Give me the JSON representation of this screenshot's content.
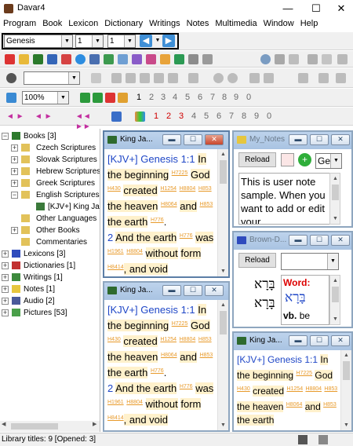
{
  "window": {
    "title": "Davar4",
    "minimize": "—",
    "maximize": "☐",
    "close": "✕"
  },
  "menu": [
    "Program",
    "Book",
    "Lexicon",
    "Dictionary",
    "Writings",
    "Notes",
    "Multimedia",
    "Window",
    "Help"
  ],
  "nav": {
    "book": "Genesis",
    "chapter": "1",
    "verse": "1"
  },
  "toolbar3": {
    "zoom": "100%"
  },
  "numbers_gray": [
    "1",
    "2",
    "3",
    "4",
    "5",
    "6",
    "7",
    "8",
    "9",
    "0"
  ],
  "numbers_red": [
    "1",
    "2",
    "3"
  ],
  "numbers_red_rest": [
    "4",
    "5",
    "6",
    "7",
    "8",
    "9",
    "0"
  ],
  "tree": {
    "books": "Books [3]",
    "czech": "Czech Scriptures",
    "slovak": "Slovak Scriptures",
    "hebrew": "Hebrew Scriptures",
    "greek": "Greek Scriptures",
    "english": "English Scriptures",
    "kjv": "[KJV+] King Ja",
    "other_lang": "Other Languages",
    "other_books": "Other Books",
    "commentaries": "Commentaries",
    "lexicons": "Lexicons [3]",
    "dictionaries": "Dictionaries [1]",
    "writings": "Writings [1]",
    "notes": "Notes [1]",
    "audio": "Audio [2]",
    "pictures": "Pictures [53]"
  },
  "status": "Library titles: 9  [Opened: 3]",
  "bible_pane_title": "King Ja...",
  "bible_pane_title_small": "King Ja...",
  "bible": {
    "ref": "[KJV+] Genesis 1:1",
    "w_in": "In",
    "w_the_beginning": "the beginning",
    "s1": "H7225",
    "w_god": "God",
    "s2": "H430",
    "w_created": "created",
    "s3": "H1254",
    "s4": "H8804",
    "s5": "H853",
    "w_the_heaven": "the heaven",
    "s6": "H8064",
    "w_and": "and",
    "s7": "H853",
    "w_the_earth": "the earth",
    "s8": "H776",
    "dot": ".",
    "v2": "2",
    "w_and_the_earth": "And the earth",
    "s9": "H776",
    "w_was": "was",
    "s10": "H1961",
    "s11": "H8804",
    "w_without": "without",
    "w_form": "form",
    "s12": "H8414",
    "w_and_void": ", and void"
  },
  "notes": {
    "title": "My_Notes",
    "reload": "Reload",
    "lang": "Ge",
    "text": "This is user note sample. When you want to add or edit your"
  },
  "brown": {
    "title": "Brown-D...",
    "reload": "Reload",
    "word_label": "Word:",
    "hebrew": "בָּרָא",
    "hebrew2": "בָּרָא",
    "pos": "vb.",
    "be": "be"
  }
}
